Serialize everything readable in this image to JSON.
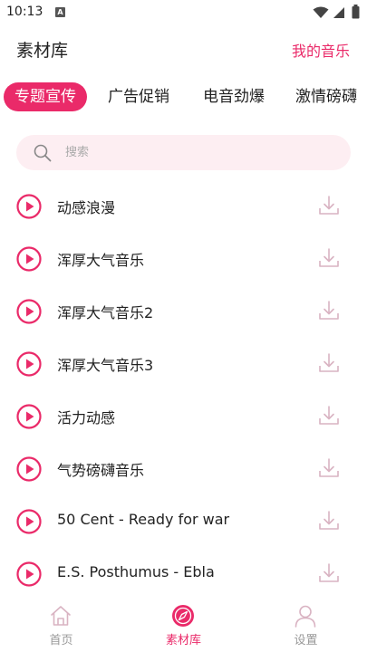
{
  "status_bar": {
    "time": "10:13",
    "notification_glyph": "A",
    "icons": [
      "wifi-icon",
      "signal-icon",
      "battery-icon"
    ]
  },
  "header": {
    "title": "素材库",
    "my_music_label": "我的音乐"
  },
  "tabs": [
    {
      "label": "专题宣传",
      "active": true
    },
    {
      "label": "广告促销",
      "active": false
    },
    {
      "label": "电音劲爆",
      "active": false
    },
    {
      "label": "激情磅礴",
      "active": false
    }
  ],
  "search": {
    "placeholder": "搜索",
    "value": ""
  },
  "tracks": [
    {
      "title": "动感浪漫"
    },
    {
      "title": "浑厚大气音乐"
    },
    {
      "title": "浑厚大气音乐2"
    },
    {
      "title": "浑厚大气音乐3"
    },
    {
      "title": "活力动感"
    },
    {
      "title": "气势磅礴音乐"
    },
    {
      "title": "50 Cent - Ready for war"
    },
    {
      "title": "E.S. Posthumus - Ebla"
    }
  ],
  "bottom_nav": [
    {
      "label": "首页",
      "icon": "home-icon",
      "active": false
    },
    {
      "label": "素材库",
      "icon": "compass-icon",
      "active": true
    },
    {
      "label": "设置",
      "icon": "user-icon",
      "active": false
    }
  ],
  "colors": {
    "accent": "#ea2a69",
    "search_background": "#fdeef2",
    "muted_icon": "#d9b3c2",
    "inactive_text": "#999999"
  }
}
